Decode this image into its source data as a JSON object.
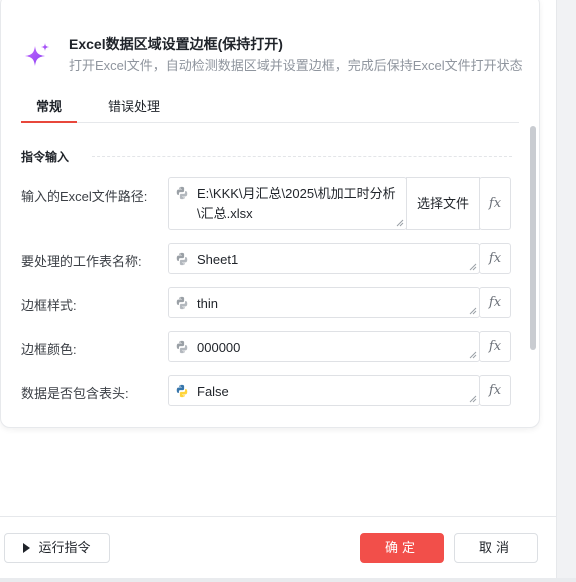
{
  "header": {
    "title": "Excel数据区域设置边框(保持打开)",
    "subtitle": "打开Excel文件，自动检测数据区域并设置边框，完成后保持Excel文件打开状态"
  },
  "tabs": [
    {
      "label": "常规",
      "active": true
    },
    {
      "label": "错误处理",
      "active": false
    }
  ],
  "section": {
    "title": "指令输入"
  },
  "fields": [
    {
      "label": "输入的Excel文件路径:",
      "value": "E:\\KKK\\月汇总\\2025\\机加工时分析\n\\汇总.xlsx",
      "icon": "python-gray-icon"
    },
    {
      "label": "要处理的工作表名称:",
      "value": "Sheet1",
      "icon": "python-gray-icon"
    },
    {
      "label": "边框样式:",
      "value": "thin",
      "icon": "python-gray-icon"
    },
    {
      "label": "边框颜色:",
      "value": "000000",
      "icon": "python-gray-icon"
    },
    {
      "label": "数据是否包含表头:",
      "value": "False",
      "icon": "python-color-icon"
    }
  ],
  "file_button": {
    "label": "选择文件"
  },
  "fx_label": "fx",
  "footer": {
    "run_label": "运行指令",
    "ok_label": "确定",
    "cancel_label": "取消"
  },
  "colors": {
    "accent": "#f24f4a",
    "tab_underline": "#e8473b",
    "sparkle": "#a855f7"
  }
}
